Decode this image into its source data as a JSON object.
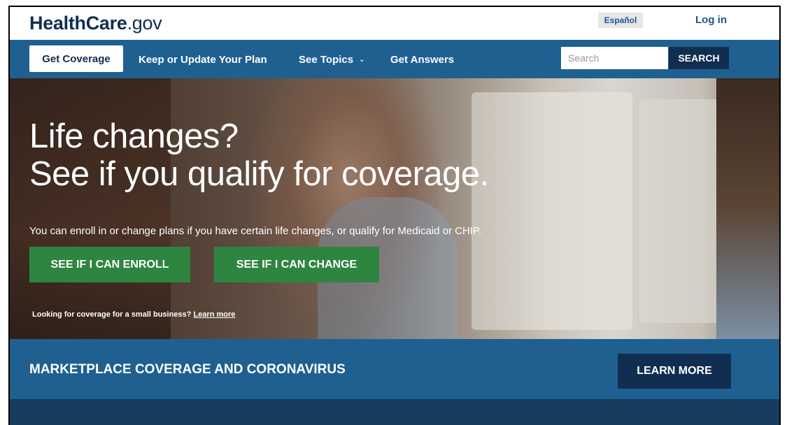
{
  "header": {
    "logo_main": "HealthCare",
    "logo_suffix": ".gov",
    "espanol_label": "Español",
    "login_label": "Log in"
  },
  "nav": {
    "items": [
      {
        "label": "Get Coverage",
        "active": true
      },
      {
        "label": "Keep or Update Your Plan"
      },
      {
        "label": "See Topics"
      },
      {
        "label": "Get Answers"
      }
    ],
    "see_topics_chevron": "⌄",
    "search_placeholder": "Search",
    "search_button": "SEARCH"
  },
  "hero": {
    "title_line1": "Life changes?",
    "title_line2": "See if you qualify for coverage.",
    "subtitle": "You can enroll in or change plans if you have certain life changes, or qualify for Medicaid or CHIP.",
    "enroll_button": "SEE IF I CAN ENROLL",
    "change_button": "SEE IF I CAN CHANGE",
    "small_business_text": "Looking for coverage for a small business?",
    "small_business_link": "Learn more"
  },
  "banner": {
    "title": "MARKETPLACE COVERAGE AND CORONAVIRUS",
    "button": "LEARN MORE"
  },
  "colors": {
    "brand_dark": "#112e51",
    "nav_blue": "#1f6091",
    "link_blue": "#205493",
    "button_green": "#2e8540"
  }
}
